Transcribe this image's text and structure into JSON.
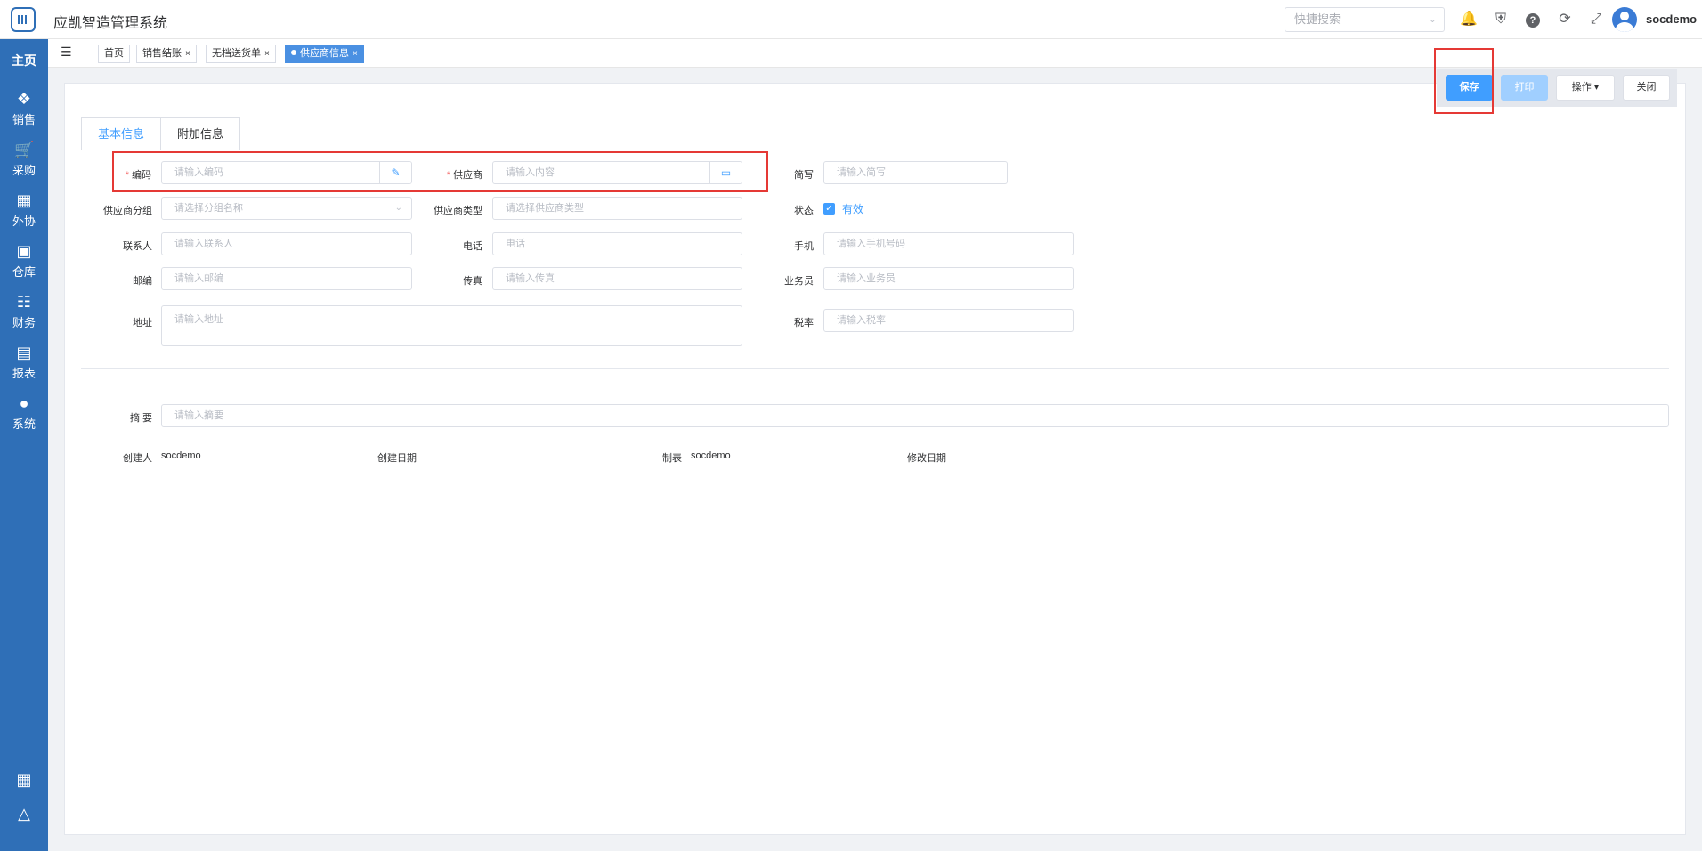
{
  "app": {
    "title": "应凯智造管理系统"
  },
  "header": {
    "search_placeholder": "快捷搜索",
    "icons": [
      "bell-icon",
      "shield-icon",
      "help-icon",
      "refresh-icon",
      "fullscreen-icon"
    ],
    "username": "socdemo"
  },
  "sidebar": {
    "home": "主页",
    "items": [
      {
        "label": "销售",
        "icon": "users-icon"
      },
      {
        "label": "采购",
        "icon": "cart-icon"
      },
      {
        "label": "外协",
        "icon": "outsource-icon"
      },
      {
        "label": "仓库",
        "icon": "warehouse-icon"
      },
      {
        "label": "财务",
        "icon": "finance-icon"
      },
      {
        "label": "报表",
        "icon": "chart-icon"
      },
      {
        "label": "系统",
        "icon": "person-icon"
      }
    ]
  },
  "page_tabs": [
    {
      "label": "首页"
    },
    {
      "label": "销售结账",
      "close": "×"
    },
    {
      "label": "无档送货单",
      "close": "×"
    },
    {
      "label": "供应商信息",
      "close": "×",
      "active": true
    }
  ],
  "actions": {
    "save": "保存",
    "print": "打印",
    "operate": "操作 ▾",
    "close": "关闭"
  },
  "form_tabs": [
    "基本信息",
    "附加信息"
  ],
  "form": {
    "code": {
      "label": "编码",
      "placeholder": "请输入编码"
    },
    "supplier": {
      "label": "供应商",
      "placeholder": "请输入内容"
    },
    "abbr": {
      "label": "简写",
      "placeholder": "请输入简写"
    },
    "group": {
      "label": "供应商分组",
      "placeholder": "请选择分组名称"
    },
    "type": {
      "label": "供应商类型",
      "placeholder": "请选择供应商类型"
    },
    "status": {
      "label": "状态",
      "value": "有效",
      "checked": true
    },
    "contact": {
      "label": "联系人",
      "placeholder": "请输入联系人"
    },
    "phone": {
      "label": "电话",
      "placeholder": "电话"
    },
    "mobile": {
      "label": "手机",
      "placeholder": "请输入手机号码"
    },
    "zip": {
      "label": "邮编",
      "placeholder": "请输入邮编"
    },
    "fax": {
      "label": "传真",
      "placeholder": "请输入传真"
    },
    "salesman": {
      "label": "业务员",
      "placeholder": "请输入业务员"
    },
    "address": {
      "label": "地址",
      "placeholder": "请输入地址"
    },
    "tax": {
      "label": "税率",
      "placeholder": "请输入税率"
    },
    "summary": {
      "label": "摘 要",
      "placeholder": "请输入摘要"
    }
  },
  "meta": {
    "creator_label": "创建人",
    "creator": "socdemo",
    "created_label": "创建日期",
    "maker_label": "制表",
    "maker": "socdemo",
    "modified_label": "修改日期"
  },
  "colors": {
    "primary": "#409eff",
    "sidebar": "#2f6fb7",
    "highlight": "#e53935"
  }
}
